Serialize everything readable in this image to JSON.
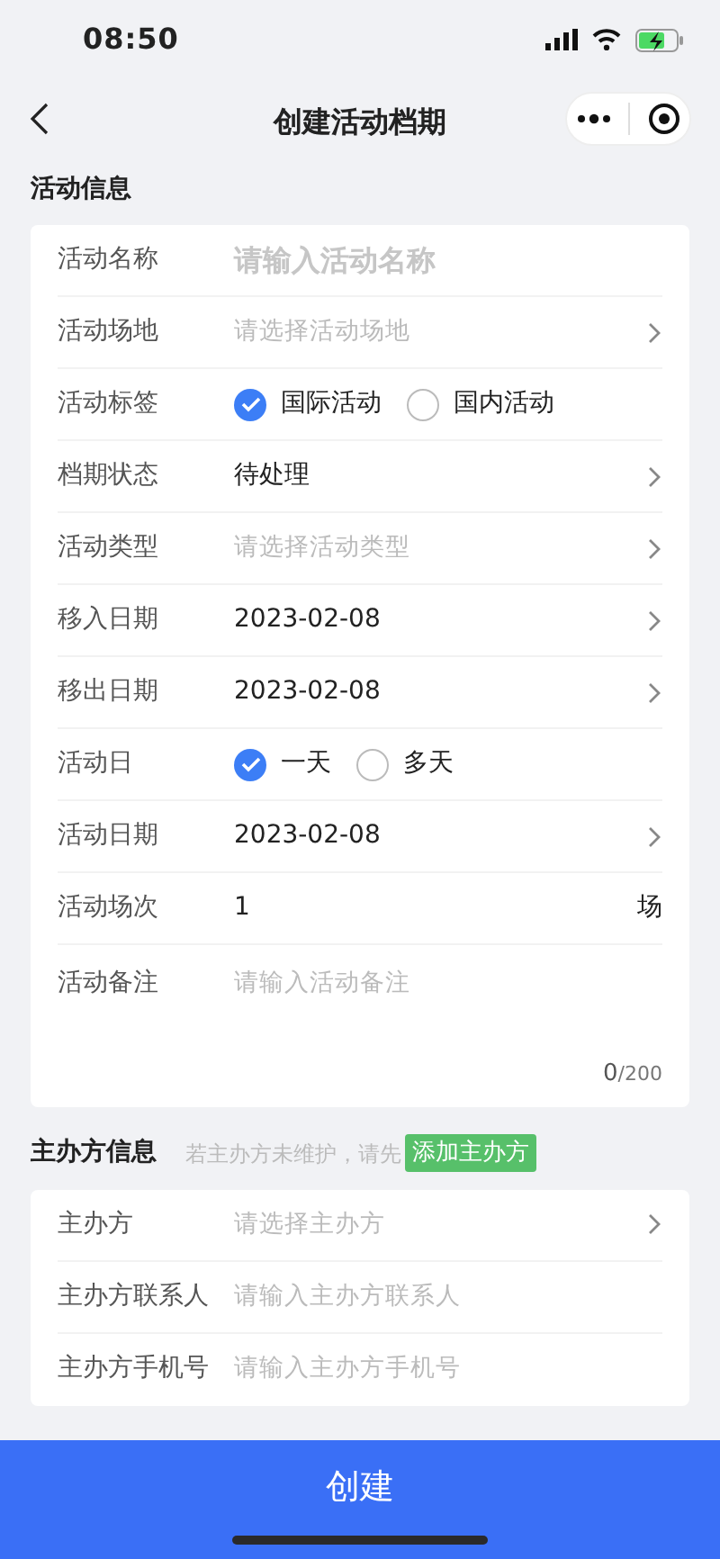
{
  "status_bar": {
    "time": "08:50"
  },
  "nav": {
    "title": "创建活动档期"
  },
  "activity_section": {
    "title": "活动信息",
    "rows": [
      {
        "kind": "input",
        "label": "活动名称",
        "placeholder": "请输入活动名称",
        "prominent": true
      },
      {
        "kind": "select",
        "label": "活动场地",
        "placeholder": "请选择活动场地"
      },
      {
        "kind": "radio",
        "label": "活动标签",
        "options": [
          {
            "label": "国际活动",
            "selected": true
          },
          {
            "label": "国内活动",
            "selected": false
          }
        ]
      },
      {
        "kind": "select",
        "label": "档期状态",
        "value": "待处理"
      },
      {
        "kind": "select",
        "label": "活动类型",
        "placeholder": "请选择活动类型"
      },
      {
        "kind": "select",
        "label": "移入日期",
        "value": "2023-02-08"
      },
      {
        "kind": "select",
        "label": "移出日期",
        "value": "2023-02-08"
      },
      {
        "kind": "radio",
        "label": "活动日",
        "options": [
          {
            "label": "一天",
            "selected": true
          },
          {
            "label": "多天",
            "selected": false
          }
        ]
      },
      {
        "kind": "select",
        "label": "活动日期",
        "value": "2023-02-08"
      },
      {
        "kind": "input",
        "label": "活动场次",
        "value": "1",
        "unit": "场"
      },
      {
        "kind": "textarea",
        "label": "活动备注",
        "placeholder": "请输入活动备注",
        "count": "0",
        "max": "/200"
      }
    ]
  },
  "organizer_section": {
    "title": "主办方信息",
    "hint": "若主办方未维护，请先",
    "add_button": "添加主办方",
    "rows": [
      {
        "kind": "select",
        "label": "主办方",
        "placeholder": "请选择主办方"
      },
      {
        "kind": "input",
        "label": "主办方联系人",
        "placeholder": "请输入主办方联系人"
      },
      {
        "kind": "input",
        "label": "主办方手机号",
        "placeholder": "请输入主办方手机号"
      }
    ]
  },
  "submit_button": "创建"
}
